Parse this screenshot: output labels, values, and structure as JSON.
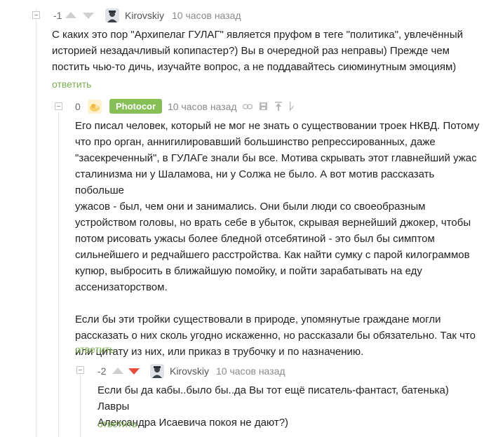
{
  "comments": [
    {
      "rating": "-1",
      "username": "Kirovskiy",
      "time": "10 часов назад",
      "lines": [
        "С каких это пор \"Архипелаг ГУЛАГ\" является пруфом в теге \"политика\", увлечённый",
        "историей незадачливый копипастер?) Вы в очередной раз неправы) Прежде чем",
        "постить чью-то дичь, изучайте вопрос, а не поддавайтесь сиюминутным эмоциям)"
      ],
      "reply": "ответить"
    },
    {
      "rating": "0",
      "username": "Photocor",
      "time": "10 часов назад",
      "lines": [
        "Его писал человек, который не мог не знать о существовании троек НКВД. Потому",
        "что про орган, аннигилировавший большинство репрессированных, даже",
        "\"засекреченный\", в ГУЛАГе знали бы все. Мотива скрывать этот главнейший ужас",
        "сталинизма ни у Шаламова, ни у Солжа не было. А вот мотив рассказать побольше",
        "ужасов - был, чем они и занимались. Они были люди со своеобразным",
        "устройством головы, но врать себе в убыток, скрывая вернейший джокер, чтобы",
        "потом рисовать ужасы более бледной отсебятиной - это был бы симптом",
        "сильнейшего и редчайшего расстройства. Как найти сумку с парой килограммов",
        "купюр, выбросить в ближайшую помойку, и пойти зарабатывать на еду",
        "ассенизаторством.",
        "",
        "Если бы эти тройки существовали в природе, упомянутые граждане могли",
        "рассказать о них сколь угодно искаженно, но рассказали бы обязательно. Так что",
        "или цитату из них, или приказ в трубочку и по назначению."
      ],
      "reply": "ответить"
    },
    {
      "rating": "-2",
      "username": "Kirovskiy",
      "time": "10 часов назад",
      "lines": [
        "Если бы да кабы..было бы..да Вы тот ещё писатель-фантаст, батенька) Лавры",
        "Александра Исаевича покоя не дают?)"
      ],
      "reply": "ответить"
    }
  ],
  "colors": {
    "accent": "#86bf56",
    "reply_link": "#7cae52",
    "downvote_active": "#e74c3c",
    "vote_inactive": "#cfcfcf"
  },
  "icons": {
    "comment2_tools": [
      "link-icon",
      "save-icon",
      "pin-icon",
      "branch-icon"
    ]
  }
}
